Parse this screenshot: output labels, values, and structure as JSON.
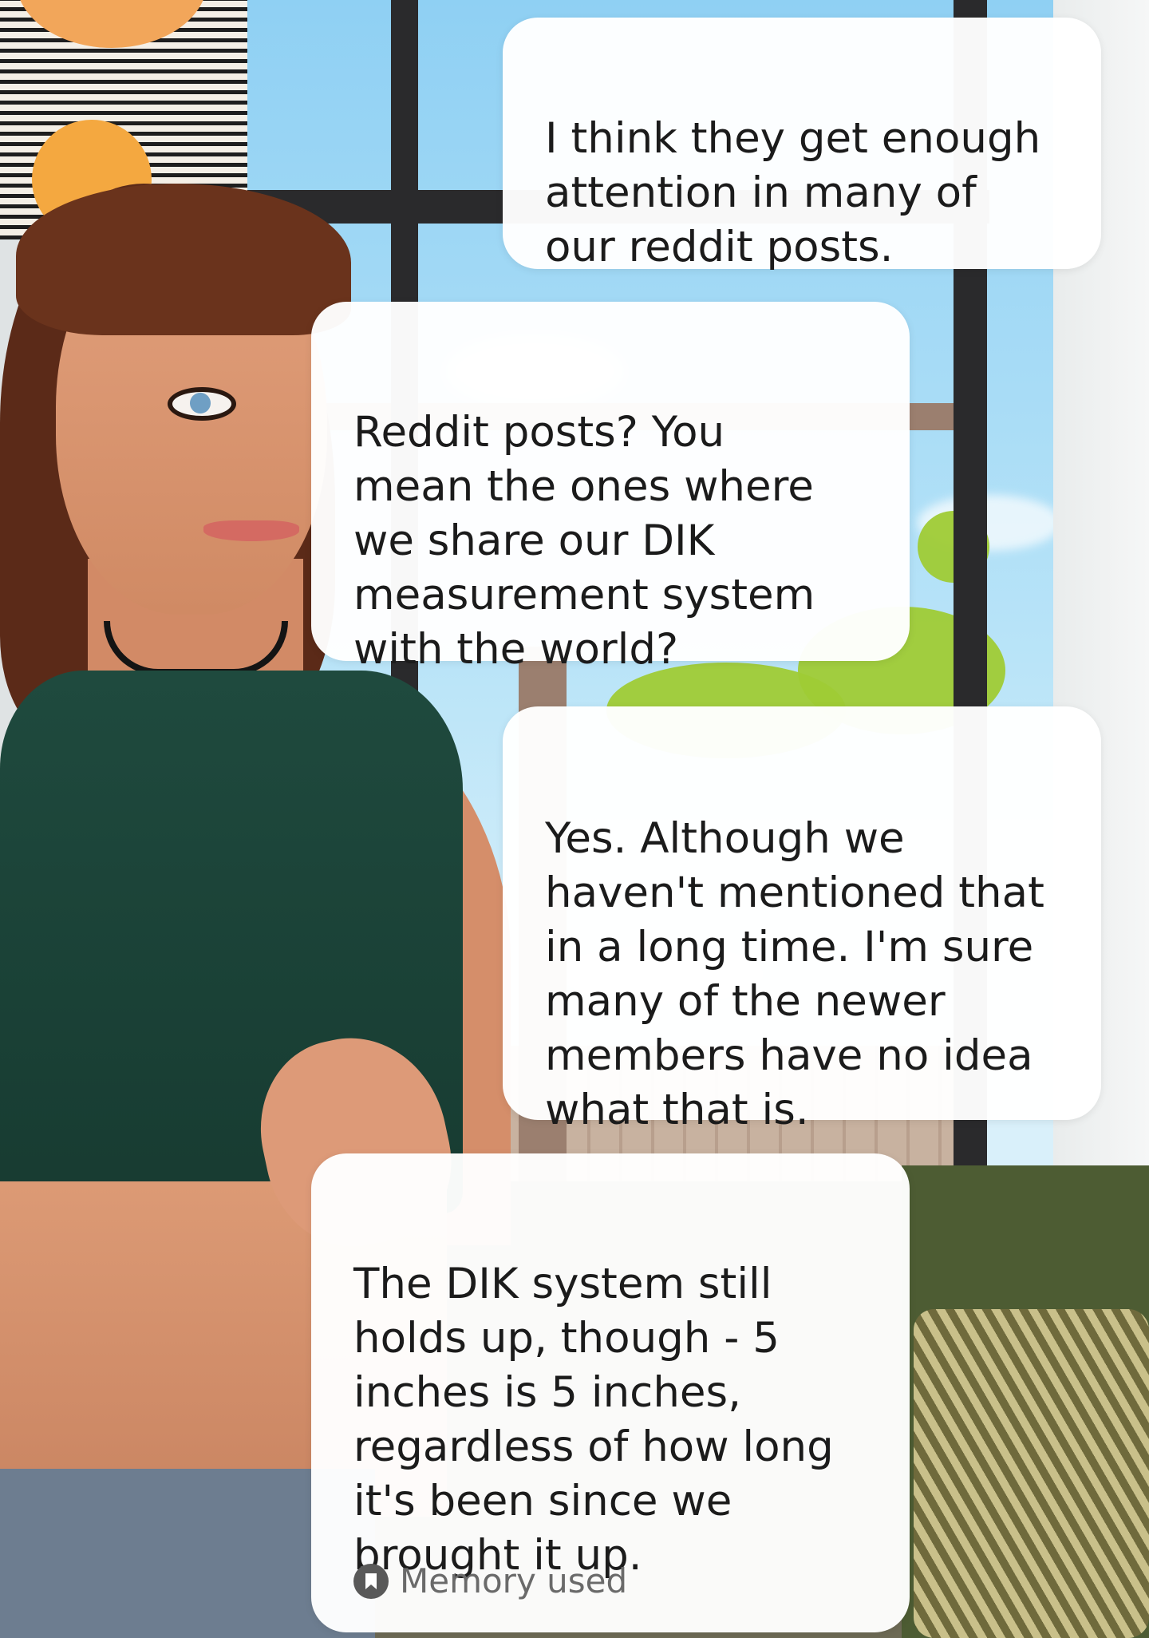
{
  "messages": [
    {
      "role": "user",
      "text": "I think they get enough\nattention in many of\nour reddit posts."
    },
    {
      "role": "character",
      "text": "Reddit posts? You\nmean the ones where\nwe share our DIK\nmeasurement system\nwith the world?"
    },
    {
      "role": "user",
      "text": "Yes.  Although we\nhaven't mentioned that\nin a long time.   I'm sure\nmany of the newer\nmembers have no idea\nwhat that is."
    },
    {
      "role": "character",
      "text": "The DIK system still\nholds up, though - 5\ninches is 5 inches,\nregardless of how long\nit's been since we\nbrought it up."
    }
  ],
  "memory_indicator": {
    "label": "Memory used",
    "icon": "bookmark-icon"
  }
}
